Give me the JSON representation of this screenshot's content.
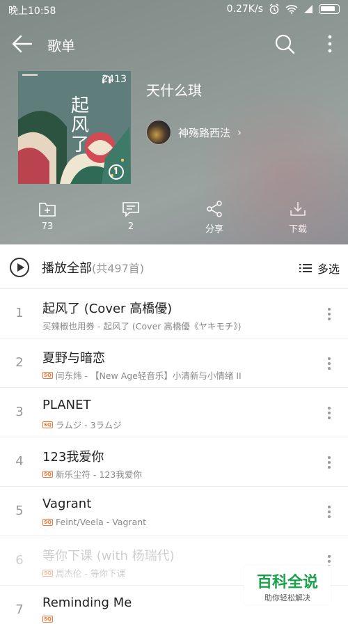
{
  "status_bar": {
    "time": "晚上10:58",
    "speed": "0.27K/s"
  },
  "nav": {
    "title": "歌单"
  },
  "playlist": {
    "cover_title": "起风了",
    "listen_count": "2413",
    "name": "天什么琪",
    "creator": "神殇路西法",
    "creator_chevron": "›"
  },
  "actions": [
    {
      "label": "73",
      "icon": "add-folder-icon"
    },
    {
      "label": "2",
      "icon": "comment-icon"
    },
    {
      "label": "分享",
      "icon": "share-icon"
    },
    {
      "label": "下载",
      "icon": "download-icon"
    }
  ],
  "play_all": {
    "label": "播放全部",
    "count": "(共497首)",
    "multi_select": "多选"
  },
  "quality_badge": "SQ",
  "songs": [
    {
      "index": "1",
      "title": "起风了 (Cover 高橋優)",
      "subtitle": "买辣椒也用券 - 起风了 (Cover 高橋優《ヤキモチ》)",
      "sq": false,
      "dim": false
    },
    {
      "index": "2",
      "title": "夏野与暗恋",
      "subtitle": "闫东炜 - 【New Age轻音乐】小清新与小情绪 II",
      "sq": true,
      "dim": false
    },
    {
      "index": "3",
      "title": "PLANET",
      "subtitle": "ラムジ - 3ラムジ",
      "sq": true,
      "dim": false
    },
    {
      "index": "4",
      "title": "123我爱你",
      "subtitle": "新乐尘符 - 123我爱你",
      "sq": true,
      "dim": false
    },
    {
      "index": "5",
      "title": "Vagrant",
      "subtitle": "Feint/Veela - Vagrant",
      "sq": true,
      "dim": false
    },
    {
      "index": "6",
      "title": "等你下课 (with 杨瑞代)",
      "subtitle": "周杰伦 - 等你下课",
      "sq": true,
      "dim": true
    },
    {
      "index": "7",
      "title": "Reminding Me",
      "subtitle": "",
      "sq": true,
      "dim": false
    }
  ],
  "watermark": {
    "title": "百科全说",
    "subtitle": "助你轻松解决"
  }
}
